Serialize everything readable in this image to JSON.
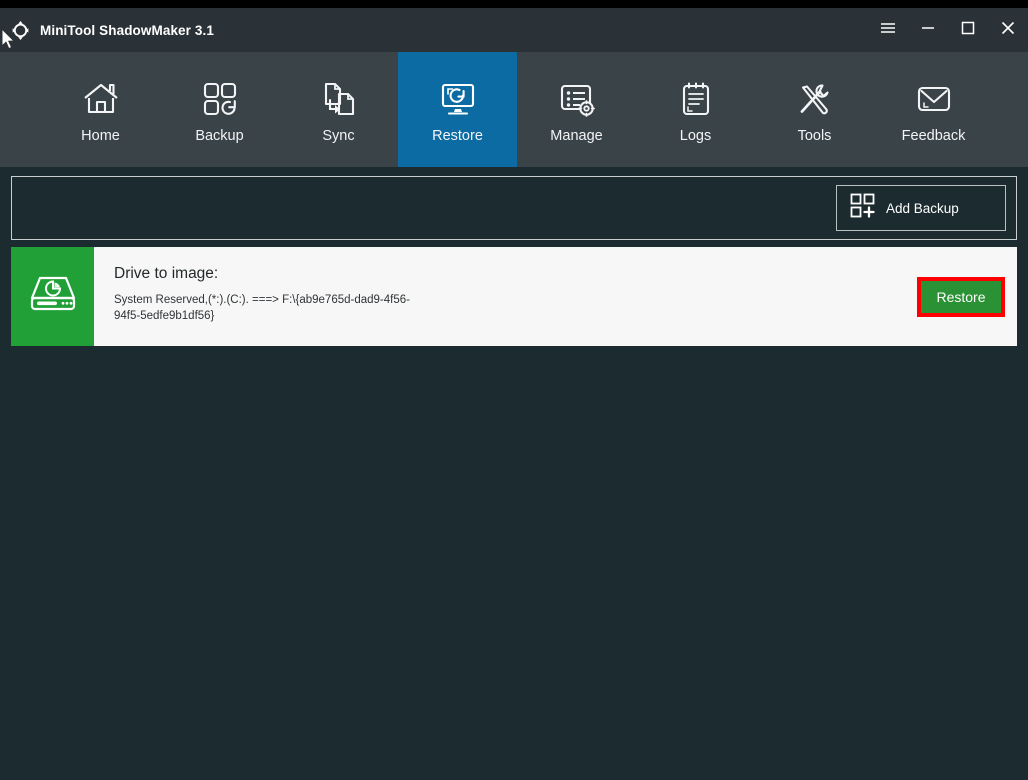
{
  "window": {
    "title": "MiniTool ShadowMaker 3.1",
    "logo_icon": "shadowmaker-logo-icon",
    "controls": [
      {
        "name": "menu-button",
        "icon": "hamburger-menu-icon",
        "label": "Menu"
      },
      {
        "name": "minimize-button",
        "icon": "minimize-icon",
        "label": "Minimize"
      },
      {
        "name": "maximize-button",
        "icon": "maximize-icon",
        "label": "Maximize"
      },
      {
        "name": "close-button",
        "icon": "close-icon",
        "label": "Close"
      }
    ]
  },
  "nav": {
    "active": "Restore",
    "items": [
      {
        "label": "Home",
        "icon": "home-icon",
        "active": false
      },
      {
        "label": "Backup",
        "icon": "backup-icon",
        "active": false
      },
      {
        "label": "Sync",
        "icon": "sync-icon",
        "active": false
      },
      {
        "label": "Restore",
        "icon": "restore-icon",
        "active": true
      },
      {
        "label": "Manage",
        "icon": "manage-icon",
        "active": false
      },
      {
        "label": "Logs",
        "icon": "logs-icon",
        "active": false
      },
      {
        "label": "Tools",
        "icon": "tools-icon",
        "active": false
      },
      {
        "label": "Feedback",
        "icon": "feedback-icon",
        "active": false
      }
    ]
  },
  "toolbar": {
    "add_backup_label": "Add Backup",
    "add_backup_icon": "add-backup-grid-plus-icon"
  },
  "backup_entry": {
    "thumb_icon": "hard-drive-icon",
    "title": "Drive to image:",
    "path": " System Reserved,(*:).(C:). ===> F:\\{ab9e765d-dad9-4f56-94f5-5edfe9b1df56}",
    "restore_label": "Restore"
  },
  "colors": {
    "window_bg": "#1c2b30",
    "titlebar_bg": "#2b3237",
    "navbar_bg": "#3a4347",
    "nav_active_blue": "#0d6ba3",
    "card_bg": "#f7f7f7",
    "thumb_green": "#21a038",
    "restore_green": "#2a9134",
    "annotation_red": "#ff0000",
    "text_light": "#f2f4f5",
    "text_dark": "#23282b"
  }
}
